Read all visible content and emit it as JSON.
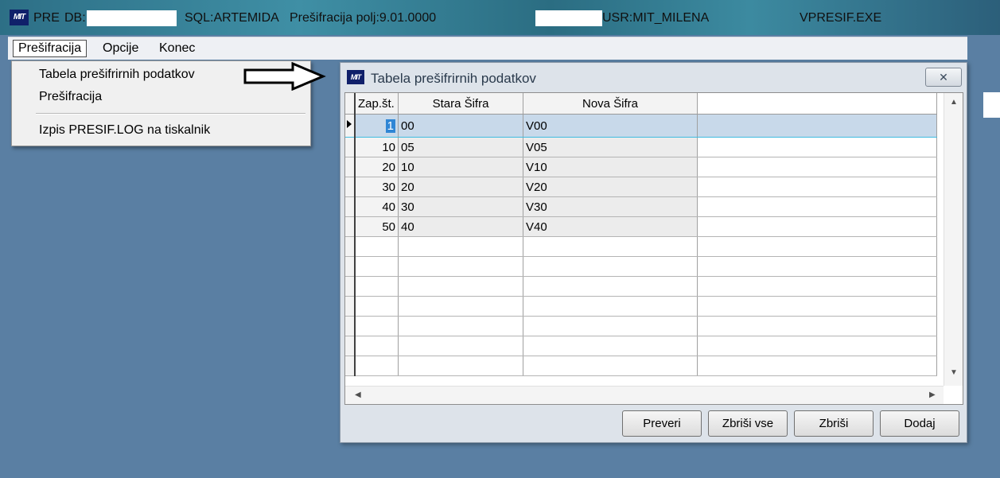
{
  "window": {
    "title_app": "PRE",
    "title_db_label": "DB:",
    "title_sql": "SQL:ARTEMIDA",
    "title_module": "Prešifracija polj:9.01.0000",
    "title_underscore": "_",
    "title_user": "USR:MIT_MILENA",
    "title_exe": "VPRESIF.EXE",
    "icon_text": "MIT"
  },
  "menubar": {
    "items": [
      "Prešifracija",
      "Opcije",
      "Konec"
    ]
  },
  "dropdown": {
    "items": [
      "Tabela prešifrirnih podatkov",
      "Prešifracija",
      "Izpis PRESIF.LOG na tiskalnik"
    ]
  },
  "dialog": {
    "title": "Tabela prešifrirnih podatkov",
    "icon_text": "MIT",
    "close_glyph": "✕",
    "columns": [
      "Zap.št.",
      "Stara Šifra",
      "Nova Šifra"
    ],
    "rows": [
      {
        "zap": "1",
        "stara": "00",
        "nova": "V00"
      },
      {
        "zap": "10",
        "stara": "05",
        "nova": "V05"
      },
      {
        "zap": "20",
        "stara": "10",
        "nova": "V10"
      },
      {
        "zap": "30",
        "stara": "20",
        "nova": "V20"
      },
      {
        "zap": "40",
        "stara": "30",
        "nova": "V30"
      },
      {
        "zap": "50",
        "stara": "40",
        "nova": "V40"
      }
    ],
    "selected_row_index": 0,
    "buttons": [
      "Preveri",
      "Zbriši vse",
      "Zbriši",
      "Dodaj"
    ]
  },
  "icons": {
    "row_indicator": "current-row-pointer",
    "scroll_up": "scroll-up-arrow",
    "scroll_down": "scroll-down-arrow",
    "scroll_left": "scroll-left-arrow",
    "scroll_right": "scroll-right-arrow",
    "annotation": "outline-arrow-right"
  },
  "colors": {
    "desktop": "#5a7fa3",
    "selection": "#2f86d5",
    "row_highlight": "#c8d9ea"
  }
}
